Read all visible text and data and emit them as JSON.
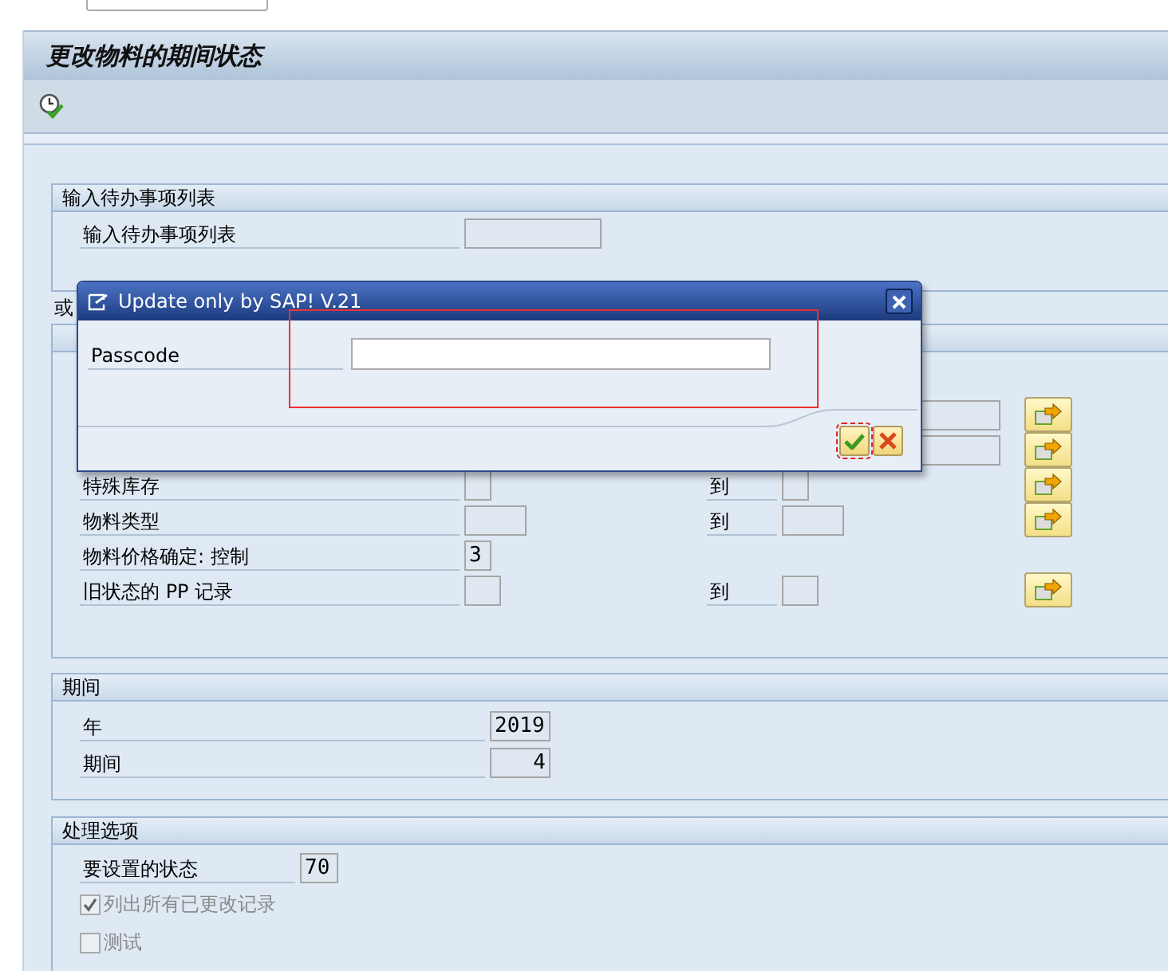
{
  "page_title": "更改物料的期间状态",
  "toolbar": {
    "buttons": [
      {
        "kind": "execute"
      }
    ]
  },
  "worklist_group": {
    "title": "输入待办事项列表",
    "fields": [
      {
        "label": "输入待办事项列表"
      }
    ]
  },
  "or_label": "或",
  "selection_group": {
    "rows": [
      {
        "kind": "hidden",
        "multi": true
      },
      {
        "kind": "hidden",
        "multi": true
      },
      {
        "kind": "range",
        "label": "特殊库存",
        "to": "到",
        "multi": true
      },
      {
        "kind": "range",
        "label": "物料类型",
        "to": "到",
        "multi": true
      },
      {
        "kind": "single",
        "label": "物料价格确定: 控制",
        "value": "3",
        "multi": false
      },
      {
        "kind": "range",
        "label": "旧状态的 PP 记录",
        "to": "到",
        "multi": true
      }
    ]
  },
  "period_group": {
    "title": "期间",
    "fields": [
      {
        "label": "年",
        "value": "2019"
      },
      {
        "label": "期间",
        "value": "4"
      }
    ]
  },
  "options_group": {
    "title": "处理选项",
    "fields": [
      {
        "label": "要设置的状态",
        "value": "70"
      }
    ],
    "checkboxes": [
      {
        "label": "列出所有已更改记录",
        "checked": true,
        "disabled": true
      },
      {
        "label": "测试",
        "checked": false,
        "disabled": true
      }
    ]
  },
  "dialog": {
    "title": "Update only by SAP! V.21",
    "fields": [
      {
        "label": "Passcode"
      }
    ],
    "highlighted": true,
    "buttons": [
      {
        "kind": "confirm",
        "focused": true
      },
      {
        "kind": "cancel",
        "focused": false
      }
    ]
  }
}
